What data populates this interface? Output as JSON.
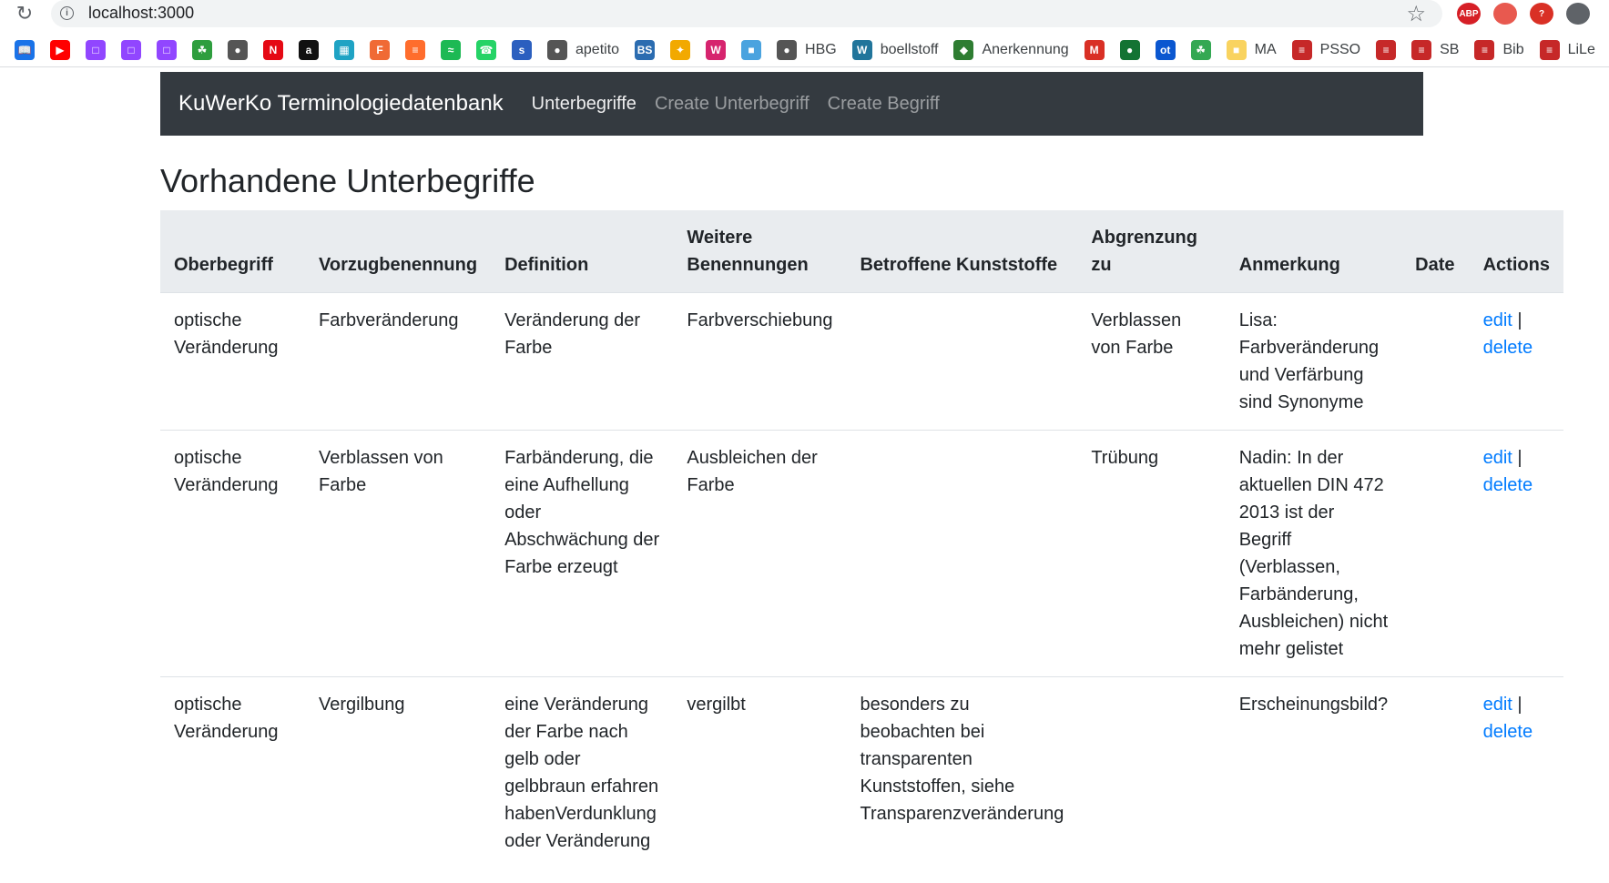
{
  "browser": {
    "url": "localhost:3000",
    "bookmarks": [
      {
        "icon": "book-icon",
        "label": "",
        "color": "#1a73e8"
      },
      {
        "icon": "youtube-icon",
        "label": "",
        "color": "#ff0000"
      },
      {
        "icon": "twitch-icon",
        "label": "",
        "color": "#9146ff"
      },
      {
        "icon": "twitch-icon",
        "label": "",
        "color": "#9146ff"
      },
      {
        "icon": "twitch-icon",
        "label": "",
        "color": "#9146ff"
      },
      {
        "icon": "leaf-icon",
        "label": "",
        "color": "#2e9e3e"
      },
      {
        "icon": "globe-icon",
        "label": "",
        "color": "#555555"
      },
      {
        "icon": "netflix-icon",
        "label": "",
        "color": "#e50914"
      },
      {
        "icon": "amazon-icon",
        "label": "",
        "color": "#111111"
      },
      {
        "icon": "card-icon",
        "label": "",
        "color": "#1fa3c4"
      },
      {
        "icon": "f-icon",
        "label": "",
        "color": "#f06a35"
      },
      {
        "icon": "stack-icon",
        "label": "",
        "color": "#ff6d2d"
      },
      {
        "icon": "spotify-icon",
        "label": "",
        "color": "#1db954"
      },
      {
        "icon": "whatsapp-icon",
        "label": "",
        "color": "#25d366"
      },
      {
        "icon": "s-icon",
        "label": "",
        "color": "#2b5fbf"
      },
      {
        "icon": "globe-icon",
        "label": "apetito",
        "color": "#555555"
      },
      {
        "icon": "bs-icon",
        "label": "",
        "color": "#2b6cb0"
      },
      {
        "icon": "spark-icon",
        "label": "",
        "color": "#f2a900"
      },
      {
        "icon": "wm-icon",
        "label": "",
        "color": "#d6246e"
      },
      {
        "icon": "map-icon",
        "label": "",
        "color": "#4aa3df"
      },
      {
        "icon": "globe-icon",
        "label": "HBG",
        "color": "#555555"
      },
      {
        "icon": "wordpress-icon",
        "label": "boellstoff",
        "color": "#21759b"
      },
      {
        "icon": "crest-icon",
        "label": "Anerkennung",
        "color": "#2e7d32"
      },
      {
        "icon": "gmail-icon",
        "label": "",
        "color": "#d93025"
      },
      {
        "icon": "circle-icon",
        "label": "",
        "color": "#137333"
      },
      {
        "icon": "ot-icon",
        "label": "",
        "color": "#0b57d0"
      },
      {
        "icon": "leaf-icon",
        "label": "",
        "color": "#34a853"
      },
      {
        "icon": "folder-icon",
        "label": "MA",
        "color": "#f9d35f"
      },
      {
        "icon": "lines-icon",
        "label": "PSSO",
        "color": "#c62828"
      },
      {
        "icon": "lines-icon",
        "label": "",
        "color": "#c62828"
      },
      {
        "icon": "lines-icon",
        "label": "SB",
        "color": "#c62828"
      },
      {
        "icon": "lines-icon",
        "label": "Bib",
        "color": "#c62828"
      },
      {
        "icon": "lines-icon",
        "label": "LiLe",
        "color": "#c62828"
      }
    ],
    "extensions": [
      {
        "icon": "abp-icon",
        "text": "ABP",
        "color": "#d61f26"
      },
      {
        "icon": "pdf-icon",
        "text": "",
        "color": "#e8594f"
      },
      {
        "icon": "question-icon",
        "text": "?",
        "color": "#d93025"
      },
      {
        "icon": "puzzle-icon",
        "text": "",
        "color": "#5f6368"
      }
    ]
  },
  "navbar": {
    "brand": "KuWerKo Terminologiedatenbank",
    "links": [
      "Unterbegriffe",
      "Create Unterbegriff",
      "Create Begriff"
    ]
  },
  "page": {
    "title": "Vorhandene Unterbegriffe"
  },
  "table": {
    "columns": [
      "Oberbegriff",
      "Vorzugbenennung",
      "Definition",
      "Weitere Benennungen",
      "Betroffene Kunststoffe",
      "Abgrenzung zu",
      "Anmerkung",
      "Date",
      "Actions"
    ],
    "rows": [
      {
        "oberbegriff": "optische Veränderung",
        "vorzugbenennung": "Farbveränderung",
        "definition": "Veränderung der Farbe",
        "weitere": "Farbverschiebung",
        "kunststoffe": "",
        "abgrenzung": "Verblassen von Farbe",
        "anmerkung": "Lisa: Farbveränderung und Verfärbung sind Synonyme",
        "date": "",
        "edit": "edit",
        "separator": "|",
        "delete": "delete"
      },
      {
        "oberbegriff": "optische Veränderung",
        "vorzugbenennung": "Verblassen von Farbe",
        "definition": "Farbänderung, die eine Aufhellung oder Abschwächung der Farbe erzeugt",
        "weitere": "Ausbleichen der Farbe",
        "kunststoffe": "",
        "abgrenzung": "Trübung",
        "anmerkung": "Nadin: In der aktuellen DIN 472 2013 ist der Begriff (Verblassen, Farbänderung, Ausbleichen) nicht mehr gelistet",
        "date": "",
        "edit": "edit",
        "separator": "|",
        "delete": "delete"
      },
      {
        "oberbegriff": "optische Veränderung",
        "vorzugbenennung": "Vergilbung",
        "definition": "eine Veränderung der Farbe nach gelb oder gelbbraun erfahren habenVerdunklung oder Veränderung",
        "weitere": "vergilbt",
        "kunststoffe": "besonders zu beobachten bei transparenten Kunststoffen, siehe Transparenzveränderung",
        "abgrenzung": "",
        "anmerkung": "Erscheinungsbild?",
        "date": "",
        "edit": "edit",
        "separator": "|",
        "delete": "delete"
      }
    ]
  }
}
